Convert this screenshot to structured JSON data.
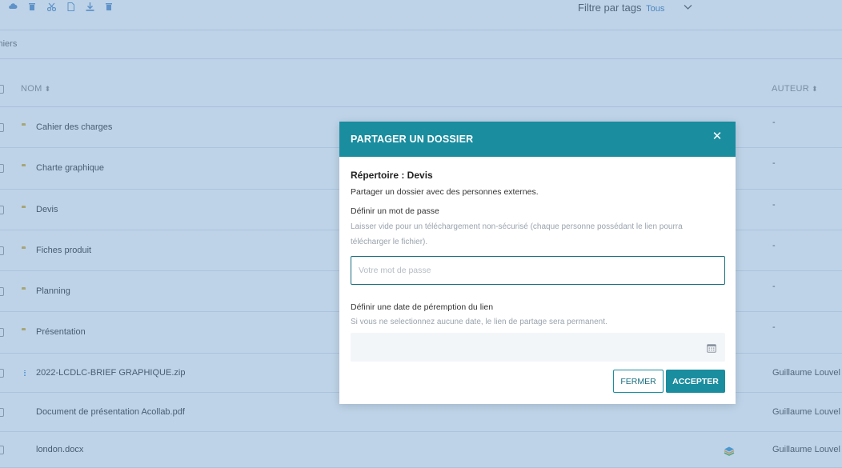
{
  "toolbar": {
    "icons": [
      "cloud-icon",
      "trash-icon",
      "scissors-icon",
      "file-icon",
      "download-icon",
      "trash-alt-icon"
    ],
    "tag_filter_label": "Filtre par tags",
    "tag_filter_value": "Tous"
  },
  "breadcrumb": {
    "text": "chiers"
  },
  "table": {
    "col_name": "NOM",
    "col_author": "AUTEUR",
    "rows": [
      {
        "name": "Cahier des charges",
        "type": "folder",
        "author": "-"
      },
      {
        "name": "Charte graphique",
        "type": "folder",
        "author": "-"
      },
      {
        "name": "Devis",
        "type": "folder",
        "author": "-"
      },
      {
        "name": "Fiches produit",
        "type": "folder",
        "author": "-"
      },
      {
        "name": "Planning",
        "type": "folder",
        "author": "-"
      },
      {
        "name": "Présentation",
        "type": "folder",
        "author": "-"
      },
      {
        "name": "2022-LCDLC-BRIEF GRAPHIQUE.zip",
        "type": "zip",
        "author": "Guillaume Louvel"
      },
      {
        "name": "Document de présentation Acollab.pdf",
        "type": "pdf",
        "author": "Guillaume Louvel"
      },
      {
        "name": "london.docx",
        "type": "doc",
        "author": "Guillaume Louvel"
      }
    ]
  },
  "modal": {
    "title": "PARTAGER UN DOSSIER",
    "subtitle": "Répertoire : Devis",
    "description": "Partager un dossier avec des personnes externes.",
    "password_label": "Définir un mot de passe",
    "password_help": "Laisser vide pour un téléchargement non-sécurisé (chaque personne possédant le lien pourra télécharger le fichier).",
    "password_placeholder": "Votre mot de passe",
    "password_value": "",
    "date_label": "Définir une date de péremption du lien",
    "date_help": "Si vous ne selectionnez aucune date, le lien de partage sera permanent.",
    "date_value": "",
    "btn_close": "FERMER",
    "btn_accept": "ACCEPTER"
  },
  "colors": {
    "accent": "#1a8d9f",
    "overlay": "#6496c8",
    "folder": "#d4b13b",
    "pdf": "#d75a4a",
    "doc": "#5d9ad6"
  }
}
